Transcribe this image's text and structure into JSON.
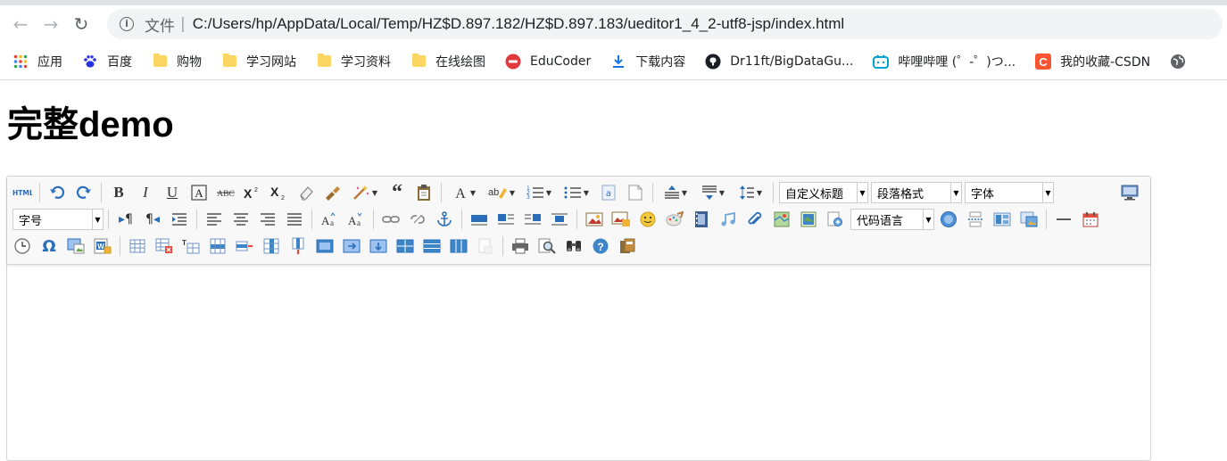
{
  "browser": {
    "url_chip": "文件",
    "url": "C:/Users/hp/AppData/Local/Temp/HZ$D.897.182/HZ$D.897.183/ueditor1_4_2-utf8-jsp/index.html"
  },
  "bookmarks": [
    {
      "label": "应用",
      "icon": "apps-grid-icon"
    },
    {
      "label": "百度",
      "icon": "baidu-paw-icon"
    },
    {
      "label": "购物",
      "icon": "folder-icon"
    },
    {
      "label": "学习网站",
      "icon": "folder-icon"
    },
    {
      "label": "学习资料",
      "icon": "folder-icon"
    },
    {
      "label": "在线绘图",
      "icon": "folder-icon"
    },
    {
      "label": "EduCoder",
      "icon": "educoder-icon"
    },
    {
      "label": "下载内容",
      "icon": "download-icon"
    },
    {
      "label": "Dr11ft/BigDataGu...",
      "icon": "github-icon"
    },
    {
      "label": "哔哩哔哩 (゜-゜)つ...",
      "icon": "bilibili-icon"
    },
    {
      "label": "我的收藏-CSDN",
      "icon": "csdn-icon"
    }
  ],
  "page": {
    "title": "完整demo"
  },
  "toolbar": {
    "combo_custom_title": "自定义标题",
    "combo_paragraph": "段落格式",
    "combo_font_family": "字体",
    "combo_font_size": "字号",
    "combo_code_lang": "代码语言"
  },
  "colors": {
    "accent_blue": "#2a6ebb",
    "folder": "#fcd663",
    "csdn": "#fc5531",
    "bilibili": "#00a1d6",
    "educoder": "#e0393e"
  }
}
